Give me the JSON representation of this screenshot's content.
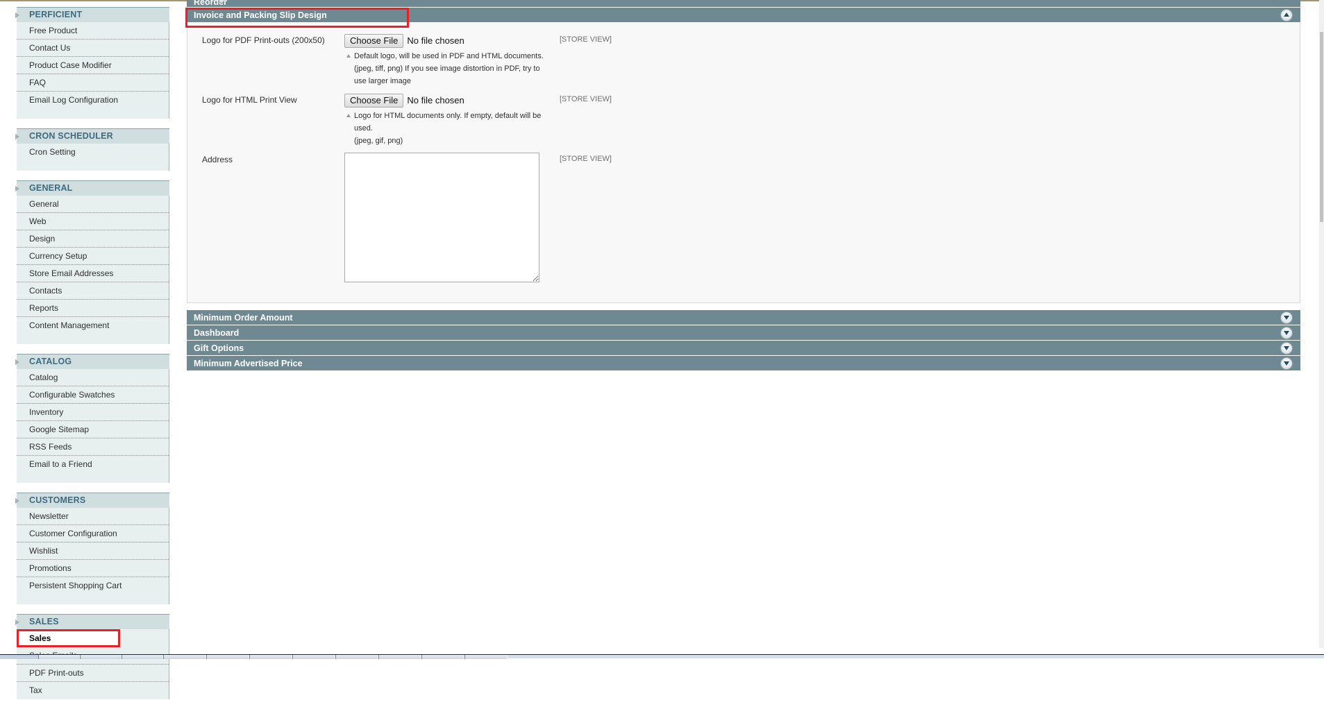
{
  "sidebar": {
    "groups": [
      {
        "title": "PERFICIENT",
        "items": [
          "Free Product",
          "Contact Us",
          "Product Case Modifier",
          "FAQ",
          "Email Log Configuration"
        ]
      },
      {
        "title": "CRON SCHEDULER",
        "items": [
          "Cron Setting"
        ]
      },
      {
        "title": "GENERAL",
        "items": [
          "General",
          "Web",
          "Design",
          "Currency Setup",
          "Store Email Addresses",
          "Contacts",
          "Reports",
          "Content Management"
        ]
      },
      {
        "title": "CATALOG",
        "items": [
          "Catalog",
          "Configurable Swatches",
          "Inventory",
          "Google Sitemap",
          "RSS Feeds",
          "Email to a Friend"
        ]
      },
      {
        "title": "CUSTOMERS",
        "items": [
          "Newsletter",
          "Customer Configuration",
          "Wishlist",
          "Promotions",
          "Persistent Shopping Cart"
        ]
      },
      {
        "title": "SALES",
        "items": [
          "Sales",
          "Sales Emails",
          "PDF Print-outs",
          "Tax"
        ],
        "active_item": "Sales"
      }
    ]
  },
  "main": {
    "partial_section": "Reorder",
    "open_section": {
      "title": "Invoice and Packing Slip Design",
      "fields": [
        {
          "label": "Logo for PDF Print-outs (200x50)",
          "button": "Choose File",
          "status": "No file chosen",
          "note_lines": [
            "Default logo, will be used in PDF and HTML documents.",
            "(jpeg, tiff, png) If you see image distortion in PDF, try to use larger image"
          ],
          "scope": "[STORE VIEW]"
        },
        {
          "label": "Logo for HTML Print View",
          "button": "Choose File",
          "status": "No file chosen",
          "note_lines": [
            "Logo for HTML documents only. If empty, default will be used.",
            "(jpeg, gif, png)"
          ],
          "scope": "[STORE VIEW]"
        },
        {
          "label": "Address",
          "value": "",
          "scope": "[STORE VIEW]"
        }
      ]
    },
    "collapsed_sections": [
      "Minimum Order Amount",
      "Dashboard",
      "Gift Options",
      "Minimum Advertised Price"
    ]
  },
  "colors": {
    "section_bar": "#6f8992",
    "sidebar_group_head": "#d1dedf",
    "sidebar_body": "#e7efef",
    "sidebar_group_text": "#3d6a7f",
    "highlight": "#e8202a"
  }
}
